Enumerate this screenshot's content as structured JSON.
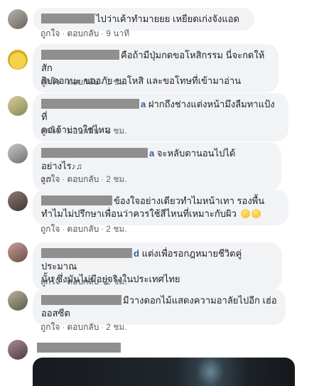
{
  "comments": [
    {
      "author": "",
      "text": "ไปว่าเค้าทำมายยย เหยียดเก่งจังแอด",
      "actions": {
        "like": "ถูกใจ",
        "reply": "ตอบกลับ",
        "time": "9 นาที"
      }
    },
    {
      "author": "",
      "text_line1": "คือถ้ามีปุ่มกดขอโหสิกรรม นี่จะกดให้สัก",
      "text_line2": "สิบดอกนะ ขออภัย ขอโหสิ และขอโทษที่เข้ามาอ่าน",
      "actions": {
        "like": "ถูกใจ",
        "reply": "ตอบกลับ",
        "time": "1 ชม."
      }
    },
    {
      "author_visible": "a",
      "text_line1": "ฝากถึงช่างแต่งหน้ามึงลืมทาแป้งที่",
      "text_line2": "คอเจ้าบ่าวใช่ไหม",
      "actions": {
        "like": "ถูกใจ",
        "reply": "ตอบกลับ",
        "time": "3 ชม."
      }
    },
    {
      "author_visible": "a",
      "text_line1": "จะหลับตานอนไปได้อย่างไร",
      "text_line2": "",
      "actions": {
        "like": "ถูกใจ",
        "reply": "ตอบกลับ",
        "time": "2 ชม."
      }
    },
    {
      "author": "",
      "text_line1": "ข้องใจอย่างเดียวทำไมหน้าเทา รองพื้น",
      "text_line2": "ทำไมไม่ปรึกษาเพื่อนว่าควรใช้สีไหนที่เหมาะกับผิว",
      "actions": {
        "like": "ถูกใจ",
        "reply": "ตอบกลับ",
        "time": "2 ชม."
      }
    },
    {
      "author_visible": "d",
      "text_line1": "แต่งเพื่อรอกฎหมายชีวิตคู่ ประมาณ",
      "text_line2": "นั้น ซึ่งมันไม่มีอยู่จริงในประเทศไทย",
      "actions": {
        "like": "ถูกใจ",
        "reply": "ตอบกลับ",
        "time": "2 ชม."
      }
    },
    {
      "author": "",
      "text_line1": "มีวางดอกไม้แสดงความอาลัยไปอีก เฮ่อ",
      "text_line2": "ออสซีต",
      "actions": {
        "like": "ถูกใจ",
        "reply": "ตอบกลับ",
        "time": "2 ชม."
      }
    }
  ],
  "icons": {
    "music_note": "music-note-icon",
    "emoji": "worried-face-icon"
  },
  "colors": {
    "bubble_bg": "#f2f3f5",
    "author_link": "#385898",
    "meta_text": "#606770",
    "redaction": "#8f8f8f"
  }
}
